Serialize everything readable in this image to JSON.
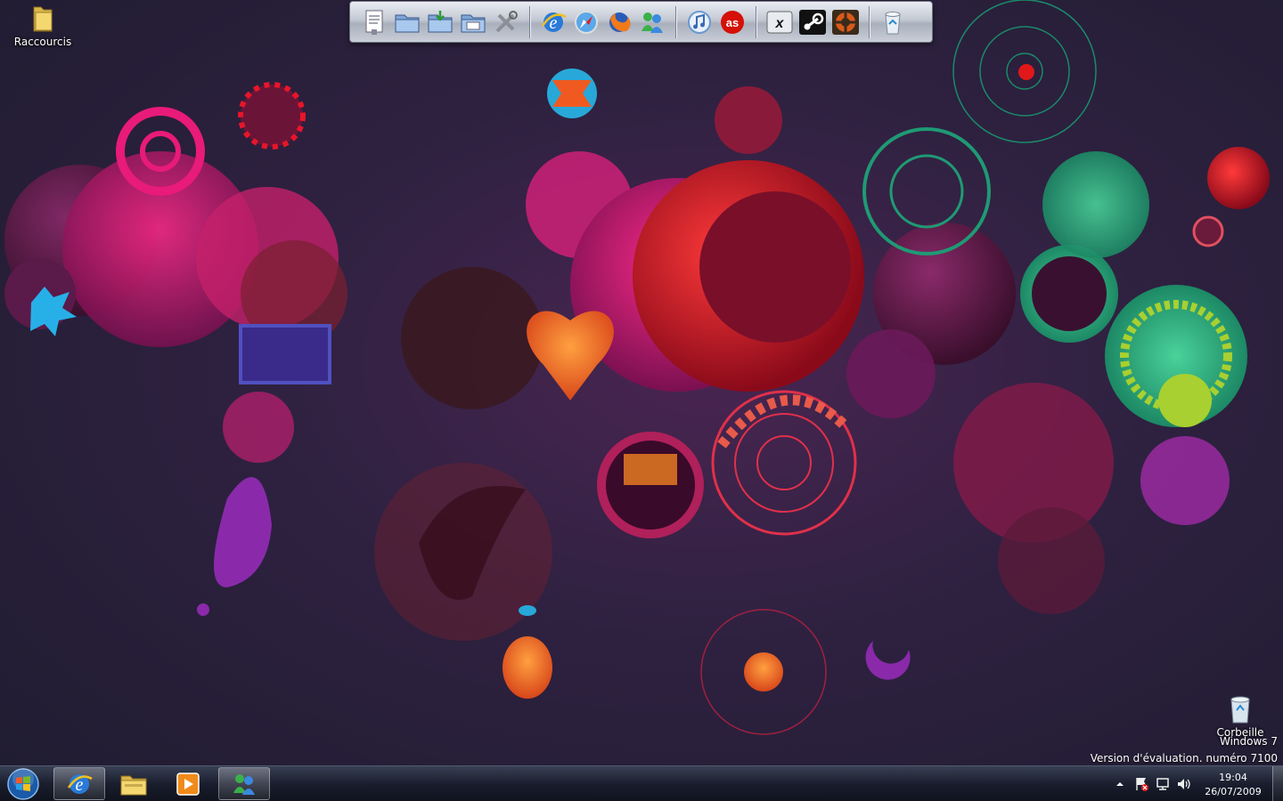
{
  "desktop": {
    "icons": [
      {
        "label": "Raccourcis",
        "icon": "folder-icon"
      },
      {
        "label": "Corbeille",
        "icon": "recycle-bin-icon"
      }
    ],
    "watermark_line1": "Windows 7",
    "watermark_line2": "Version d'évaluation. numéro 7100"
  },
  "dock": {
    "items": [
      {
        "icon": "document-icon"
      },
      {
        "icon": "folder-icon"
      },
      {
        "icon": "folder-download-icon"
      },
      {
        "icon": "folder-documents-icon"
      },
      {
        "icon": "tools-icon"
      },
      {
        "icon": "internet-explorer-icon"
      },
      {
        "icon": "safari-icon"
      },
      {
        "icon": "firefox-icon"
      },
      {
        "icon": "messenger-icon"
      },
      {
        "icon": "itunes-icon"
      },
      {
        "icon": "lastfm-icon"
      },
      {
        "icon": "xfire-icon"
      },
      {
        "icon": "steam-icon"
      },
      {
        "icon": "team-fortress-icon"
      },
      {
        "icon": "recycle-bin-icon"
      }
    ]
  },
  "taskbar": {
    "buttons": [
      {
        "icon": "start-orb-icon"
      },
      {
        "icon": "internet-explorer-icon",
        "active": true
      },
      {
        "icon": "explorer-icon"
      },
      {
        "icon": "media-player-icon"
      },
      {
        "icon": "messenger-icon",
        "active": true
      }
    ],
    "tray_icons": [
      "show-hidden-icons-icon",
      "action-center-icon",
      "network-icon",
      "volume-icon"
    ],
    "clock": {
      "time": "19:04",
      "date": "26/07/2009"
    }
  },
  "colors": {
    "accent_pink": "#e0186f",
    "accent_red": "#e01e2e",
    "accent_teal": "#21a27a",
    "accent_orange": "#f07a1a"
  }
}
